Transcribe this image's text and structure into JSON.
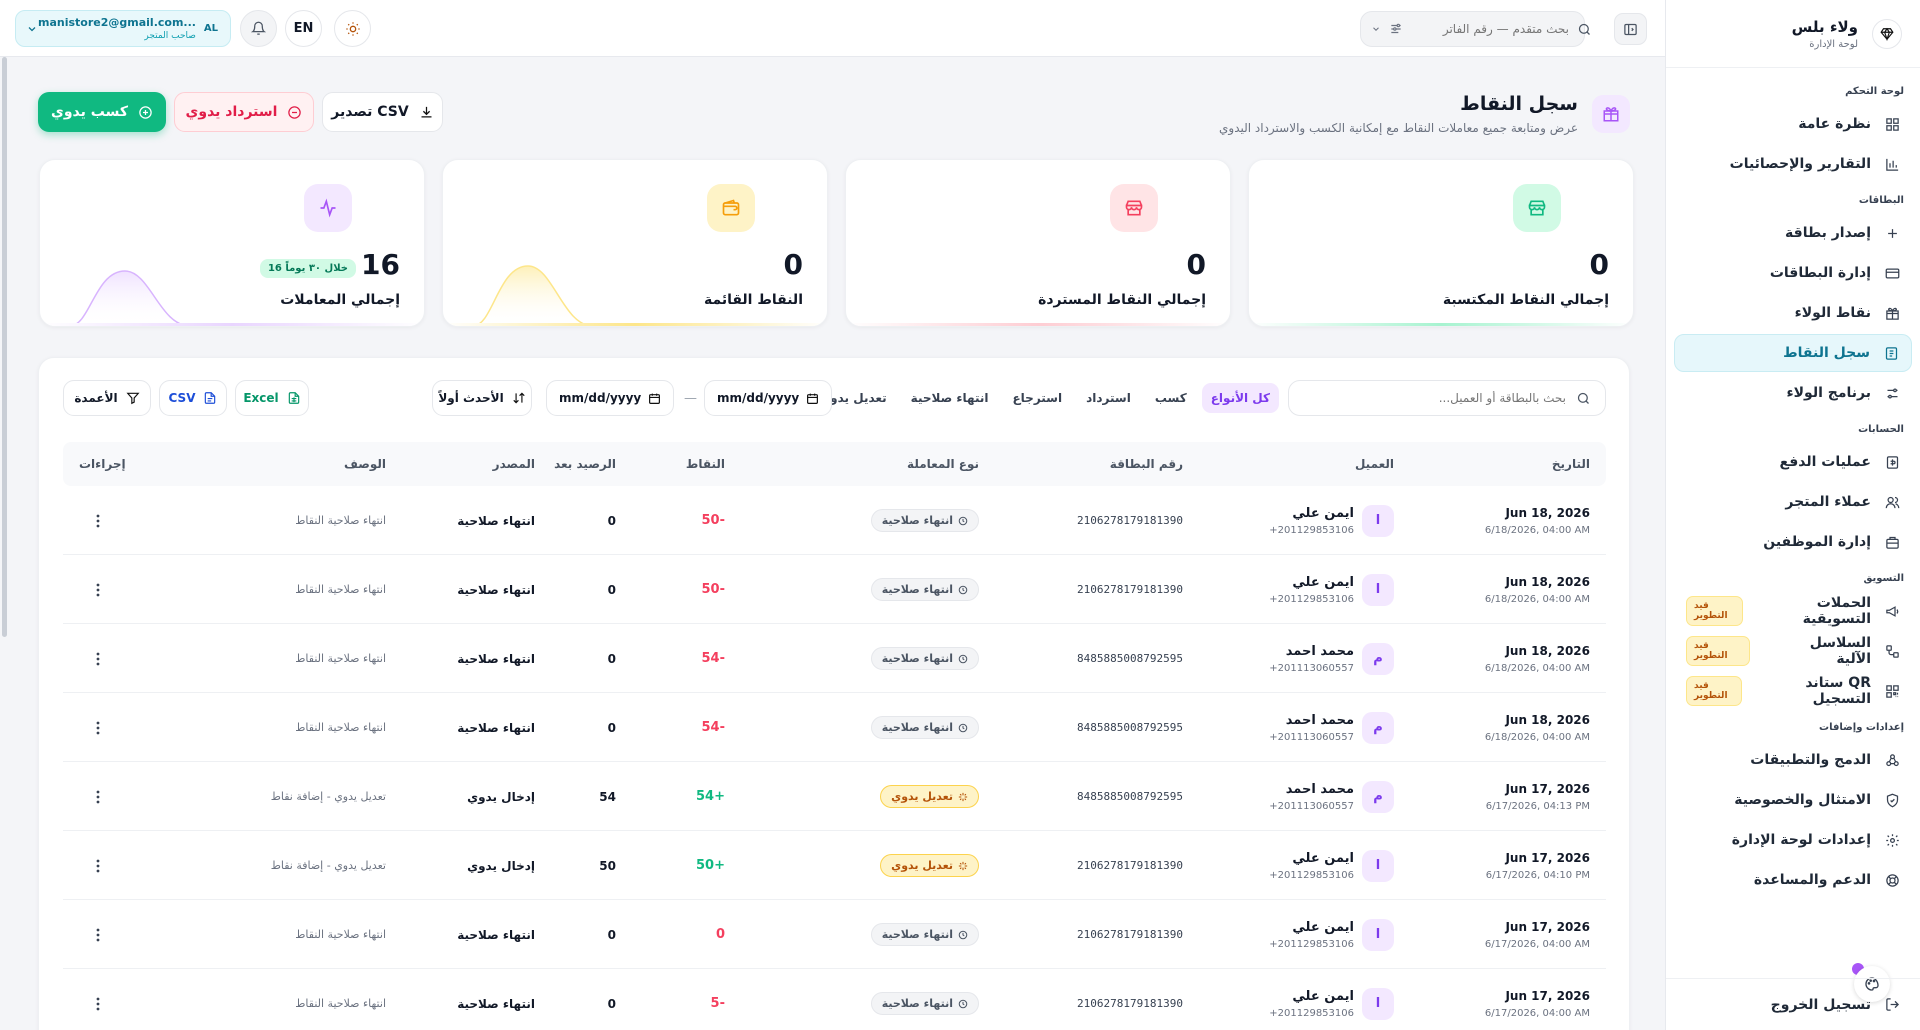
{
  "sidebar": {
    "brand_title": "ولاء بلس",
    "brand_subtitle": "لوحة الإدارة",
    "sections": {
      "dashboard": "لوحة التحكم",
      "cards": "البطاقات",
      "accounts": "الحسابات",
      "marketing": "التسويق",
      "settings": "إعدادات وإضافات"
    },
    "items": {
      "overview": "نظرة عامة",
      "reports": "التقارير والإحصائيات",
      "issue_card": "إصدار بطاقة",
      "manage_cards": "إدارة البطاقات",
      "loyalty_points": "نقاط الولاء",
      "points_log": "سجل النقاط",
      "loyalty_program": "برنامج الولاء",
      "payments": "عمليات الدفع",
      "store_customers": "عملاء المتجر",
      "staff": "إدارة الموظفين",
      "campaigns": "الحملات التسويقية",
      "automation": "السلاسل الآلية",
      "qr_stand": "ستاند QR التسجيل",
      "integrations": "الدمج والتطبيقات",
      "compliance": "الامتثال والخصوصية",
      "dashboard_settings": "إعدادات لوحة الإدارة",
      "support": "الدعم والمساعدة"
    },
    "dev_badge": "قيد التطوير",
    "logout": "تسجيل الخروج"
  },
  "topbar": {
    "user_initials": "AL",
    "user_email": "manistore2@gmail.com...",
    "user_role": "صاحب المتجر",
    "lang": "EN",
    "search_placeholder": "بحث متقدم — رقم الفاتر"
  },
  "page": {
    "title": "سجل النقاط",
    "subtitle": "عرض ومتابعة جميع معاملات النقاط مع إمكانية الكسب والاسترداد اليدوي",
    "btn_earn": "كسب يدوي",
    "btn_refund": "استرداد يدوي",
    "btn_export": "تصدير CSV"
  },
  "stats": [
    {
      "label": "إجمالي النقاط المكتسبة",
      "value": "0",
      "color": "#10b981"
    },
    {
      "label": "إجمالي النقاط المستردة",
      "value": "0",
      "color": "#f43f5e"
    },
    {
      "label": "النقاط القائمة",
      "value": "0",
      "color": "#f59e0b"
    },
    {
      "label": "إجمالي المعاملات",
      "value": "16",
      "badge": "16 خلال ٣٠ يوماً",
      "color": "#a855f7"
    }
  ],
  "table": {
    "search_placeholder": "بحث بالبطاقة أو العميل...",
    "filters": [
      "كل الأنواع",
      "كسب",
      "استرداد",
      "استرجاع",
      "انتهاء صلاحية",
      "تعديل يدوي"
    ],
    "date_from": "mm/dd/yyyy",
    "date_to": "mm/dd/yyyy",
    "sort": "الأحدث أولاً",
    "excel": "Excel",
    "csv": "CSV",
    "columns_btn": "الأعمدة",
    "headers": {
      "date": "التاريخ",
      "customer": "العميل",
      "card": "رقم البطاقة",
      "type": "نوع المعاملة",
      "points": "النقاط",
      "balance": "الرصيد بعد",
      "source": "المصدر",
      "desc": "الوصف",
      "actions": "إجراءات"
    },
    "rows": [
      {
        "date": "Jun 18, 2026",
        "time": "6/18/2026, 04:00 AM",
        "initial": "ا",
        "name": "ايمن علي",
        "phone": "+201129853106",
        "card": "2106278179181390",
        "type": "انتهاء صلاحية",
        "kind": "expire",
        "points": "50-",
        "sign": "neg",
        "balance": "0",
        "source": "انتهاء صلاحية",
        "desc": "انتهاء صلاحية النقاط"
      },
      {
        "date": "Jun 18, 2026",
        "time": "6/18/2026, 04:00 AM",
        "initial": "ا",
        "name": "ايمن علي",
        "phone": "+201129853106",
        "card": "2106278179181390",
        "type": "انتهاء صلاحية",
        "kind": "expire",
        "points": "50-",
        "sign": "neg",
        "balance": "0",
        "source": "انتهاء صلاحية",
        "desc": "انتهاء صلاحية النقاط"
      },
      {
        "date": "Jun 18, 2026",
        "time": "6/18/2026, 04:00 AM",
        "initial": "م",
        "name": "محمد احمد",
        "phone": "+201113060557",
        "card": "8485885008792595",
        "type": "انتهاء صلاحية",
        "kind": "expire",
        "points": "54-",
        "sign": "neg",
        "balance": "0",
        "source": "انتهاء صلاحية",
        "desc": "انتهاء صلاحية النقاط"
      },
      {
        "date": "Jun 18, 2026",
        "time": "6/18/2026, 04:00 AM",
        "initial": "م",
        "name": "محمد احمد",
        "phone": "+201113060557",
        "card": "8485885008792595",
        "type": "انتهاء صلاحية",
        "kind": "expire",
        "points": "54-",
        "sign": "neg",
        "balance": "0",
        "source": "انتهاء صلاحية",
        "desc": "انتهاء صلاحية النقاط"
      },
      {
        "date": "Jun 17, 2026",
        "time": "6/17/2026, 04:13 PM",
        "initial": "م",
        "name": "محمد احمد",
        "phone": "+201113060557",
        "card": "8485885008792595",
        "type": "تعديل يدوي",
        "kind": "adjust",
        "points": "54+",
        "sign": "pos",
        "balance": "54",
        "source": "إدخال يدوي",
        "desc": "تعديل يدوي - إضافة نقاط"
      },
      {
        "date": "Jun 17, 2026",
        "time": "6/17/2026, 04:10 PM",
        "initial": "ا",
        "name": "ايمن علي",
        "phone": "+201129853106",
        "card": "2106278179181390",
        "type": "تعديل يدوي",
        "kind": "adjust",
        "points": "50+",
        "sign": "pos",
        "balance": "50",
        "source": "إدخال يدوي",
        "desc": "تعديل يدوي - إضافة نقاط"
      },
      {
        "date": "Jun 17, 2026",
        "time": "6/17/2026, 04:00 AM",
        "initial": "ا",
        "name": "ايمن علي",
        "phone": "+201129853106",
        "card": "2106278179181390",
        "type": "انتهاء صلاحية",
        "kind": "expire",
        "points": "0",
        "sign": "neg",
        "balance": "0",
        "source": "انتهاء صلاحية",
        "desc": "انتهاء صلاحية النقاط"
      },
      {
        "date": "Jun 17, 2026",
        "time": "6/17/2026, 04:00 AM",
        "initial": "ا",
        "name": "ايمن علي",
        "phone": "+201129853106",
        "card": "2106278179181390",
        "type": "انتهاء صلاحية",
        "kind": "expire",
        "points": "5-",
        "sign": "neg",
        "balance": "0",
        "source": "انتهاء صلاحية",
        "desc": "انتهاء صلاحية النقاط"
      }
    ]
  }
}
